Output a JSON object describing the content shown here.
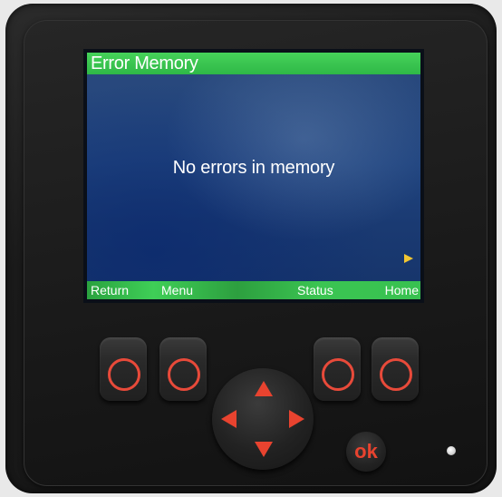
{
  "screen": {
    "title": "Error Memory",
    "message": "No errors in memory",
    "softkeys": {
      "return": "Return",
      "menu": "Menu",
      "status": "Status",
      "home": "Home"
    },
    "next_indicator_icon": "triangle-right-icon"
  },
  "keypad": {
    "ok_label": "ok",
    "arrow_icons": [
      "arrow-up-icon",
      "arrow-down-icon",
      "arrow-left-icon",
      "arrow-right-icon"
    ]
  },
  "colors": {
    "title_bar": "#2fb847",
    "soft_bar": "#38c150",
    "screen_background": "#1e3f78",
    "key_accent": "#e84a3a",
    "next_indicator": "#f2c632"
  }
}
